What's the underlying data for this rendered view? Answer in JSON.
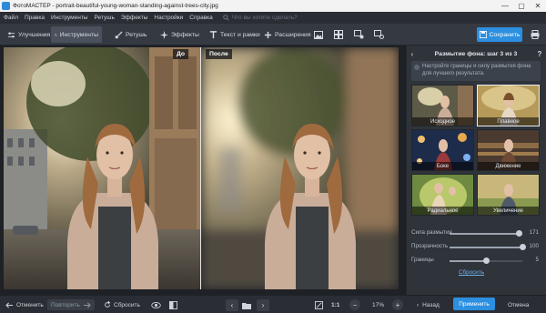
{
  "window": {
    "title": "ФотоМАСТЕР - portrait-beautiful-young-woman-standing-against-trees-city.jpg",
    "minimize": "—",
    "maximize": "▢",
    "close": "✕"
  },
  "menu": {
    "items": [
      "Файл",
      "Правка",
      "Инструменты",
      "Ретушь",
      "Эффекты",
      "Настройки",
      "Справка"
    ],
    "search_placeholder": "Что вы хотите сделать?"
  },
  "toolbar": {
    "tabs": [
      {
        "label": "Улучшения",
        "icon": "sliders-icon"
      },
      {
        "label": "Инструменты",
        "icon": "crop-icon",
        "active": true
      },
      {
        "label": "Ретушь",
        "icon": "brush-icon"
      },
      {
        "label": "Эффекты",
        "icon": "sparkle-icon"
      },
      {
        "label": "Текст и рамки",
        "icon": "text-icon"
      },
      {
        "label": "Расширения",
        "icon": "plus-icon"
      }
    ],
    "save_label": "Сохранить"
  },
  "compare": {
    "before_label": "До",
    "after_label": "После"
  },
  "panel": {
    "title": "Размытие фона: шаг 3 из 3",
    "hint": "Настройте границы и силу размытия фона для лучшего результата.",
    "thumbnails": [
      {
        "label": "Исходное",
        "selected": false
      },
      {
        "label": "Плавное",
        "selected": true
      },
      {
        "label": "Боке",
        "selected": false
      },
      {
        "label": "Движение",
        "selected": false
      },
      {
        "label": "Радиальное",
        "selected": false
      },
      {
        "label": "Увеличение",
        "selected": false
      }
    ],
    "sliders": [
      {
        "name": "Сила размытия",
        "value": 171,
        "fraction": 0.95
      },
      {
        "name": "Прозрачность",
        "value": 100,
        "fraction": 1.0
      },
      {
        "name": "Границы",
        "value": 5,
        "fraction": 0.5
      }
    ],
    "reset_link": "Сбросить"
  },
  "bottom": {
    "undo": "Отменить",
    "redo": "Повторить",
    "reset": "Сбросить",
    "zoom_fit": "1:1",
    "zoom_level": "17%",
    "back": "Назад",
    "apply": "Применить",
    "cancel": "Отмена"
  },
  "colors": {
    "accent": "#2c8fe0",
    "panel_bg": "#2f333a",
    "toolbar_bg": "#353a42"
  }
}
